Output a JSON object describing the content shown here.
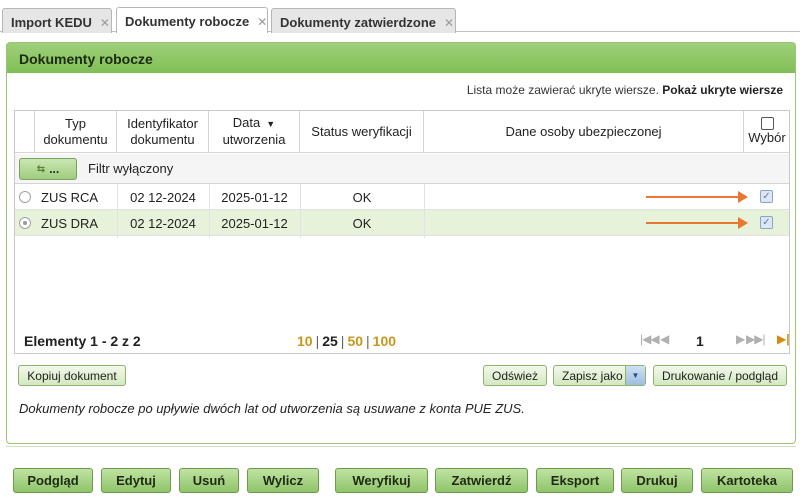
{
  "tabs": [
    {
      "label": "Import KEDU",
      "close": "✕"
    },
    {
      "label": "Dokumenty robocze",
      "close": "✕"
    },
    {
      "label": "Dokumenty zatwierdzone",
      "close": "✕"
    }
  ],
  "panel": {
    "title": "Dokumenty robocze",
    "hidden_rows_text": "Lista może zawierać ukryte wiersze.",
    "hidden_rows_link": "Pokaż ukryte wiersze"
  },
  "grid": {
    "headers": {
      "typ": [
        "Typ",
        "dokumentu"
      ],
      "id": [
        "Identyfikator",
        "dokumentu"
      ],
      "data": [
        "Data",
        "utworzenia"
      ],
      "status": "Status weryfikacji",
      "dane": "Dane osoby ubezpieczonej",
      "wybor": "Wybór"
    },
    "filter_button": "...",
    "filter_label": "Filtr wyłączony",
    "rows": [
      {
        "typ": "ZUS RCA",
        "id": "02 12-2024",
        "data": "2025-01-12",
        "status": "OK",
        "dane": "",
        "checked": true,
        "radio_selected": false
      },
      {
        "typ": "ZUS DRA",
        "id": "02 12-2024",
        "data": "2025-01-12",
        "status": "OK",
        "dane": "",
        "checked": true,
        "radio_selected": true
      }
    ]
  },
  "pager": {
    "elements": "Elementy 1 - 2 z 2",
    "sizes": [
      "10",
      "25",
      "50",
      "100"
    ],
    "current_size": "25",
    "page": "1"
  },
  "actions": {
    "kopiuj": "Kopiuj dokument",
    "odswiez": "Odśwież",
    "zapisz": "Zapisz jako",
    "drukowanie": "Drukowanie / podgląd"
  },
  "note": "Dokumenty robocze po upływie dwóch lat od utworzenia są usuwane z konta PUE ZUS.",
  "bottom_buttons": [
    "Podgląd",
    "Edytuj",
    "Usuń",
    "Wylicz",
    "Weryfikuj",
    "Zatwierdź",
    "Eksport",
    "Drukuj",
    "Kartoteka"
  ],
  "colors": {
    "accent": "#8fc46a",
    "header": "#7fbf55",
    "arrow": "#e87830",
    "page_size_link": "#c8961a"
  }
}
